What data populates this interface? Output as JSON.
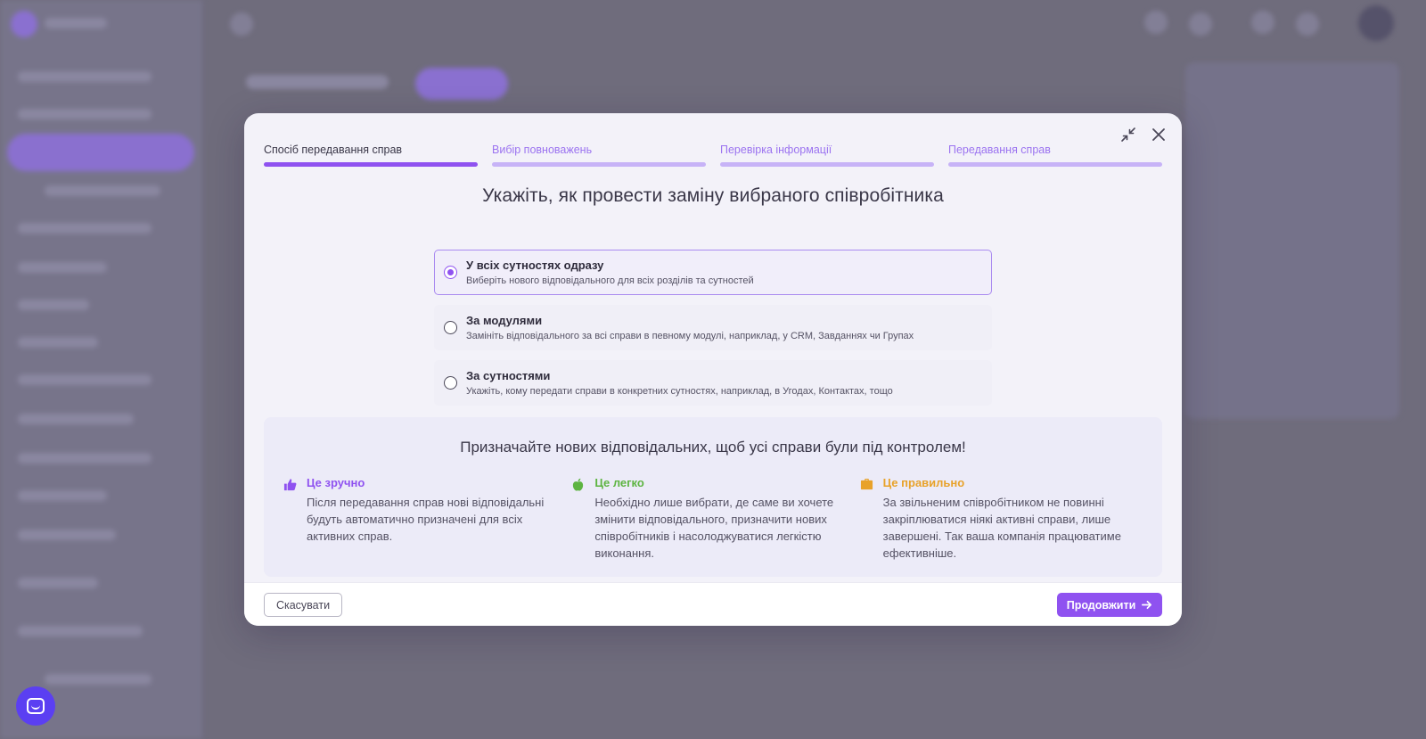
{
  "steps": [
    {
      "label": "Спосіб передавання справ",
      "active": true
    },
    {
      "label": "Вибір повноважень",
      "active": false
    },
    {
      "label": "Перевірка інформації",
      "active": false
    },
    {
      "label": "Передавання справ",
      "active": false
    }
  ],
  "title": "Укажіть, як провести заміну вибраного співробітника",
  "options": [
    {
      "title": "У всіх сутностях одразу",
      "description": "Виберіть нового відповідального для всіх розділів та сутностей",
      "selected": true
    },
    {
      "title": "За модулями",
      "description": "Замініть відповідального за всі справи в певному модулі, наприклад, у CRM, Завданнях чи Групах",
      "selected": false
    },
    {
      "title": "За сутностями",
      "description": "Укажіть, кому передати справи в конкретних сутностях, наприклад, в Угодах, Контактах, тощо",
      "selected": false
    }
  ],
  "info": {
    "title": "Призначайте нових відповідальних, щоб усі справи були під контролем!",
    "benefits": [
      {
        "icon": "thumbs-up-icon",
        "heading": "Це зручно",
        "text": "Після передавання справ нові відповідальні будуть автоматично призначені для всіх активних справ.",
        "color": "#8f52f0"
      },
      {
        "icon": "apple-icon",
        "heading": "Це легко",
        "text": "Необхідно лише вибрати, де саме ви хочете змінити відповідального, призначити нових співробітників і насолоджуватися легкістю виконання.",
        "color": "#5db441"
      },
      {
        "icon": "briefcase-icon",
        "heading": "Це правильно",
        "text": "За звільненим співробітником не повинні закріплюватися ніякі активні справи, лише завершені. Так ваша компанія працюватиме ефективніше.",
        "color": "#e8a22a"
      }
    ]
  },
  "footer": {
    "cancel_label": "Скасувати",
    "continue_label": "Продовжити"
  },
  "colors": {
    "accent": "#8f52f0",
    "overlay": "#6f6c7c"
  }
}
